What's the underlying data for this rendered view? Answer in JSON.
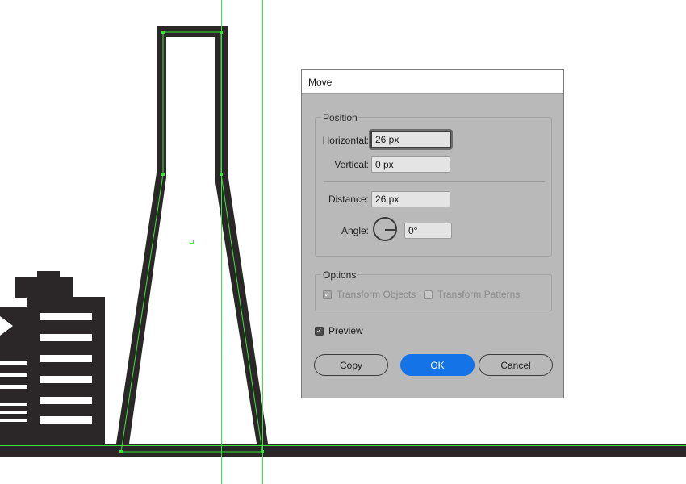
{
  "dialog": {
    "title": "Move",
    "position_group": {
      "title": "Position",
      "horizontal_label": "Horizontal:",
      "horizontal_value": "26 px",
      "vertical_label": "Vertical:",
      "vertical_value": "0 px",
      "distance_label": "Distance:",
      "distance_value": "26 px",
      "angle_label": "Angle:",
      "angle_value": "0°"
    },
    "options_group": {
      "title": "Options",
      "transform_objects_label": "Transform Objects",
      "transform_objects_checked": true,
      "transform_patterns_label": "Transform Patterns",
      "transform_patterns_checked": false
    },
    "preview_label": "Preview",
    "preview_checked": true,
    "buttons": {
      "copy": "Copy",
      "ok": "OK",
      "cancel": "Cancel"
    }
  },
  "colors": {
    "artwork": "#2b2728",
    "guide": "#39e539",
    "ok_button": "#1473e6",
    "dialog_bg": "#b9b9b9"
  }
}
